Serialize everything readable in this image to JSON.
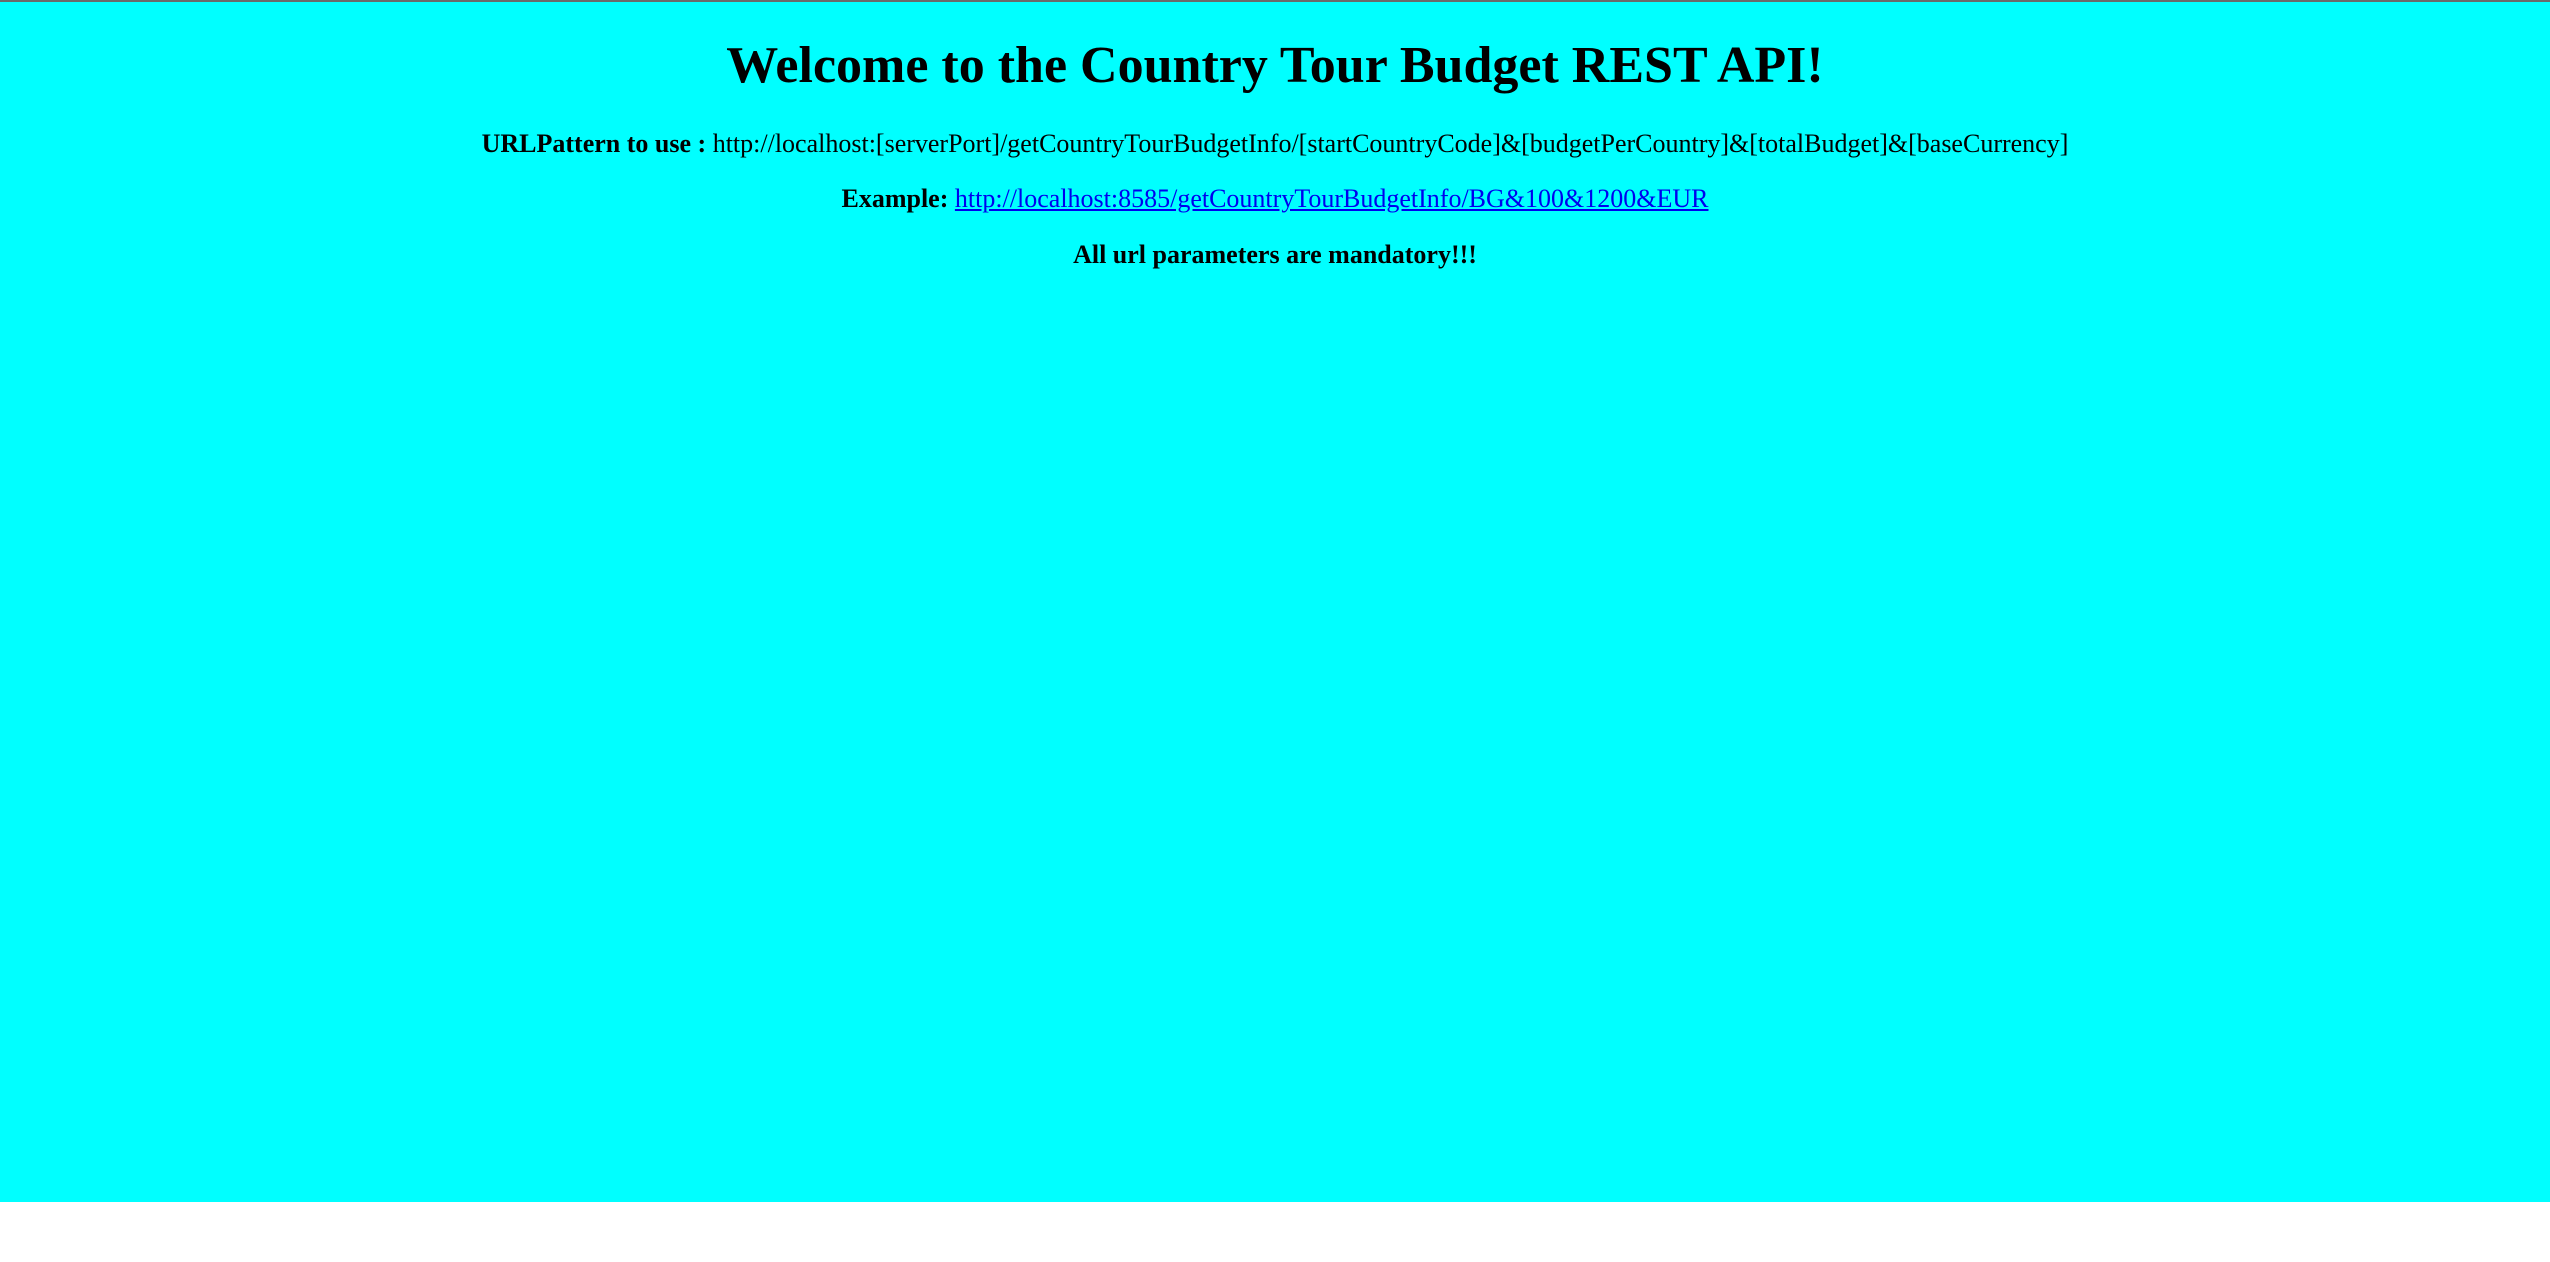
{
  "colors": {
    "background": "#00ffff",
    "link": "#0000ee",
    "text": "#000000"
  },
  "header": {
    "title": "Welcome to the Country Tour Budget REST API!"
  },
  "pattern": {
    "label": "URLPattern to use :",
    "value": "http://localhost:[serverPort]/getCountryTourBudgetInfo/[startCountryCode]&[budgetPerCountry]&[totalBudget]&[baseCurrency]"
  },
  "example": {
    "label": "Example:",
    "link_text": "http://localhost:8585/getCountryTourBudgetInfo/BG&100&1200&EUR"
  },
  "note": {
    "text": "All url parameters are mandatory!!!"
  }
}
